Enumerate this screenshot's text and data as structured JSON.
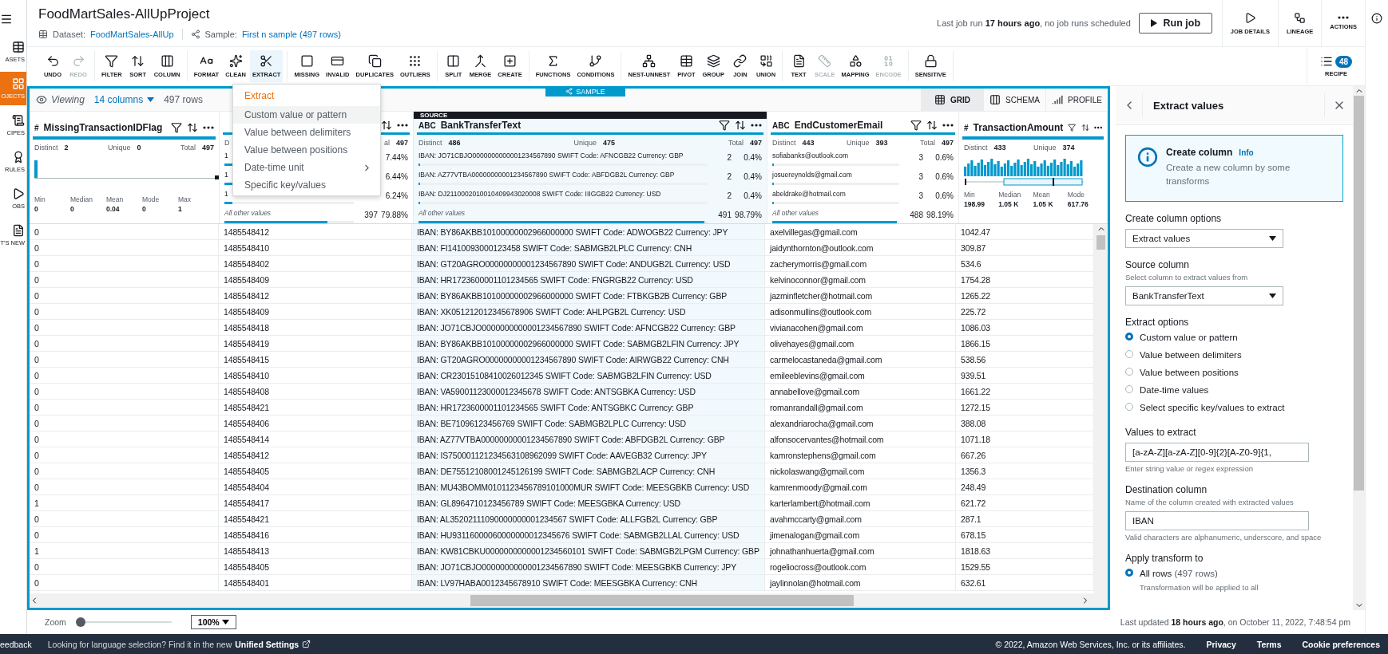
{
  "nav_rail": {
    "items": [
      {
        "label": "ASETS",
        "selected": false
      },
      {
        "label": "OJECTS",
        "selected": true
      },
      {
        "label": "CIPES",
        "selected": false
      },
      {
        "label": "RULES",
        "selected": false
      },
      {
        "label": "OBS",
        "selected": false
      },
      {
        "label": "T'S NEW",
        "selected": false
      }
    ]
  },
  "header": {
    "title": "FoodMartSales-AllUpProject",
    "dataset_label": "Dataset:",
    "dataset": "FoodMartSales-AllUp",
    "sample_label": "Sample:",
    "sample": "First n sample (497 rows)",
    "last_run": "Last job run **17 hours ago**, no job runs scheduled",
    "run_button": "Run job",
    "actions": [
      "JOB DETAILS",
      "LINEAGE",
      "ACTIONS"
    ]
  },
  "toolbar": {
    "groups": [
      {
        "items": [
          {
            "label": "UNDO",
            "disabled": false,
            "selected": false
          },
          {
            "label": "REDO",
            "disabled": true,
            "selected": false
          }
        ]
      },
      {
        "items": [
          {
            "label": "FILTER",
            "disabled": false,
            "selected": false
          },
          {
            "label": "SORT",
            "disabled": false,
            "selected": false
          },
          {
            "label": "COLUMN",
            "disabled": false,
            "selected": false
          }
        ]
      },
      {
        "items": [
          {
            "label": "FORMAT",
            "disabled": false,
            "selected": false
          },
          {
            "label": "CLEAN",
            "disabled": false,
            "selected": false
          },
          {
            "label": "EXTRACT",
            "disabled": false,
            "selected": true
          }
        ]
      },
      {
        "items": [
          {
            "label": "MISSING",
            "disabled": false,
            "selected": false
          },
          {
            "label": "INVALID",
            "disabled": false,
            "selected": false
          },
          {
            "label": "DUPLICATES",
            "disabled": false,
            "selected": false
          },
          {
            "label": "OUTLIERS",
            "disabled": false,
            "selected": false
          }
        ]
      },
      {
        "items": [
          {
            "label": "SPLIT",
            "disabled": false,
            "selected": false
          },
          {
            "label": "MERGE",
            "disabled": false,
            "selected": false
          },
          {
            "label": "CREATE",
            "disabled": false,
            "selected": false
          }
        ]
      },
      {
        "items": [
          {
            "label": "FUNCTIONS",
            "disabled": false,
            "selected": false
          },
          {
            "label": "CONDITIONS",
            "disabled": false,
            "selected": false
          }
        ]
      },
      {
        "items": [
          {
            "label": "NEST-UNNEST",
            "disabled": false,
            "selected": false
          },
          {
            "label": "PIVOT",
            "disabled": false,
            "selected": false
          },
          {
            "label": "GROUP",
            "disabled": false,
            "selected": false
          },
          {
            "label": "JOIN",
            "disabled": false,
            "selected": false
          },
          {
            "label": "UNION",
            "disabled": false,
            "selected": false
          }
        ]
      },
      {
        "items": [
          {
            "label": "TEXT",
            "disabled": false,
            "selected": false
          },
          {
            "label": "SCALE",
            "disabled": true,
            "selected": false
          },
          {
            "label": "MAPPING",
            "disabled": false,
            "selected": false
          },
          {
            "label": "ENCODE",
            "disabled": true,
            "selected": false
          }
        ]
      },
      {
        "items": [
          {
            "label": "SENSITIVE",
            "disabled": false,
            "selected": false
          }
        ]
      }
    ],
    "recipe": {
      "label": "RECIPE",
      "count": "48"
    }
  },
  "extract_menu": {
    "title": "Extract",
    "items": [
      {
        "label": "Custom value or pattern",
        "selected": true,
        "submenu": false
      },
      {
        "label": "Value between delimiters",
        "selected": false,
        "submenu": false
      },
      {
        "label": "Value between positions",
        "selected": false,
        "submenu": false
      },
      {
        "label": "Date-time unit",
        "selected": false,
        "submenu": true
      },
      {
        "label": "Specific key/values",
        "selected": false,
        "submenu": false
      }
    ]
  },
  "grid": {
    "viewing_label": "Viewing",
    "columns_link": "14 columns",
    "row_count": "497 rows",
    "sample_tag": "SAMPLE",
    "view_tabs": [
      {
        "label": "GRID",
        "selected": true
      },
      {
        "label": "SCHEMA",
        "selected": false
      },
      {
        "label": "PROFILE",
        "selected": false
      }
    ],
    "columns": [
      {
        "kind": "distribution",
        "type_mark": "#",
        "name": "MissingTransactionIDFlag",
        "source": false,
        "stats": {
          "distinct_label": "Distinct",
          "distinct": "2",
          "unique_label": "Unique",
          "unique": "0",
          "total_label": "Total",
          "total": "497"
        },
        "summary": [
          {
            "label": "Min",
            "value": "0"
          },
          {
            "label": "Median",
            "value": "0"
          },
          {
            "label": "Mean",
            "value": "0.04"
          },
          {
            "label": "Mode",
            "value": "0"
          },
          {
            "label": "Max",
            "value": "1"
          }
        ]
      },
      {
        "kind": "top_values",
        "source": false,
        "stats": {
          "distinct_label": "D",
          "total_label": "al",
          "total": "497"
        },
        "top_values": [
          {
            "value": "1",
            "percent": "7.44%",
            "level": 0.0744
          },
          {
            "value": "1",
            "percent": "6.44%",
            "level": 0.0644
          },
          {
            "value": "1",
            "percent": "6.24%",
            "level": 0.0624
          }
        ],
        "other": {
          "label": "All other values",
          "count": "397",
          "percent": "79.88%",
          "level": 0.7988
        }
      },
      {
        "kind": "top_values",
        "type_mark": "ABC",
        "name": "BankTransferText",
        "source": true,
        "source_tag": "SOURCE",
        "stats": {
          "distinct_label": "Distinct",
          "distinct": "486",
          "unique_label": "Unique",
          "unique": "475",
          "total_label": "Total",
          "total": "497"
        },
        "top_values": [
          {
            "value": "IBAN: JO71CBJO0000000000001234567890 SWIFT Code: AFNCGB22 Currency: GBP",
            "count": "2",
            "percent": "0.4%",
            "level": 0.004
          },
          {
            "value": "IBAN: AZ77VTBA00000000001234567890 SWIFT Code: ABFDGB2L Currency: GBP",
            "count": "2",
            "percent": "0.4%",
            "level": 0.004
          },
          {
            "value": "IBAN: DJ2110002010010409943020008 SWIFT Code: IIIGGB22 Currency: USD",
            "count": "2",
            "percent": "0.4%",
            "level": 0.004
          }
        ],
        "other": {
          "label": "All other values",
          "count": "491",
          "percent": "98.79%",
          "level": 0.9879
        }
      },
      {
        "kind": "top_values",
        "type_mark": "ABC",
        "name": "EndCustomerEmail",
        "source": false,
        "stats": {
          "distinct_label": "Distinct",
          "distinct": "443",
          "unique_label": "Unique",
          "unique": "393",
          "total_label": "Total",
          "total": "497"
        },
        "top_values": [
          {
            "value": "sofiabanks@outlook.com",
            "count": "3",
            "percent": "0.6%",
            "level": 0.006
          },
          {
            "value": "josuereynolds@gmail.com",
            "count": "3",
            "percent": "0.6%",
            "level": 0.006
          },
          {
            "value": "abeldrake@hotmail.com",
            "count": "3",
            "percent": "0.6%",
            "level": 0.006
          }
        ],
        "other": {
          "label": "All other values",
          "count": "488",
          "percent": "98.19%",
          "level": 0.9819
        }
      },
      {
        "kind": "histogram",
        "type_mark": "#",
        "name": "TransactionAmount",
        "source": false,
        "stats": {
          "distinct_label": "Distinct",
          "distinct": "433",
          "unique_label": "Unique",
          "unique": "374"
        },
        "summary": [
          {
            "label": "Min",
            "value": "198.99"
          },
          {
            "label": "Median",
            "value": "1.05 K"
          },
          {
            "label": "Mean",
            "value": "1.05 K"
          },
          {
            "label": "Mode",
            "value": "617.76"
          }
        ]
      }
    ],
    "rows": [
      [
        "0",
        "1485548412",
        "IBAN: BY86AKBB10100000002966000000 SWIFT Code: ADWOGB22 Currency: JPY",
        "axelvillegas@gmail.com",
        "1042.47"
      ],
      [
        "0",
        "1485548410",
        "IBAN: FI1410093000123458 SWIFT Code: SABMGB2LPLC Currency: CNH",
        "jaidynthornton@outlook.com",
        "309.87"
      ],
      [
        "0",
        "1485548402",
        "IBAN: GT20AGRO00000000001234567890 SWIFT Code: ANDUGB2L Currency: USD",
        "zacherymorris@gmail.com",
        "534.6"
      ],
      [
        "0",
        "1485548409",
        "IBAN: HR1723600001101234565 SWIFT Code: FNGRGB22 Currency: USD",
        "kelvinoconnor@gmail.com",
        "1754.28"
      ],
      [
        "0",
        "1485548412",
        "IBAN: BY86AKBB10100000002966000000 SWIFT Code: FTBKGB2B Currency: GBP",
        "jazminfletcher@hotmail.com",
        "1265.22"
      ],
      [
        "0",
        "1485548409",
        "IBAN: XK051212012345678906 SWIFT Code: AHLPGB2L Currency: USD",
        "adisonmullins@outlook.com",
        "225.72"
      ],
      [
        "0",
        "1485548418",
        "IBAN: JO71CBJO0000000000001234567890 SWIFT Code: AFNCGB22 Currency: GBP",
        "vivianacohen@gmail.com",
        "1086.03"
      ],
      [
        "0",
        "1485548419",
        "IBAN: BY86AKBB10100000002966000000 SWIFT Code: SABMGB2LFIN Currency: JPY",
        "olivehayes@gmail.com",
        "1866.15"
      ],
      [
        "0",
        "1485548415",
        "IBAN: GT20AGRO00000000001234567890 SWIFT Code: AIRWGB22 Currency: CNH",
        "carmelocastaneda@gmail.com",
        "538.56"
      ],
      [
        "0",
        "1485548410",
        "IBAN: CR23015108410026012345 SWIFT Code: SABMGB2LFIN Currency: USD",
        "emileeblevins@gmail.com",
        "939.51"
      ],
      [
        "0",
        "1485548408",
        "IBAN: VA59001123000012345678 SWIFT Code: ANTSGBKA Currency: USD",
        "annabellove@gmail.com",
        "1661.22"
      ],
      [
        "0",
        "1485548421",
        "IBAN: HR1723600001101234565 SWIFT Code: ANTSGBKC Currency: GBP",
        "romanrandall@gmail.com",
        "1272.15"
      ],
      [
        "0",
        "1485548406",
        "IBAN: BE71096123456769 SWIFT Code: SABMGB2LPLC Currency: USD",
        "alexandriarocha@gmail.com",
        "388.08"
      ],
      [
        "0",
        "1485548414",
        "IBAN: AZ77VTBA00000000001234567890 SWIFT Code: ABFDGB2L Currency: GBP",
        "alfonsocervantes@hotmail.com",
        "1071.18"
      ],
      [
        "0",
        "1485548412",
        "IBAN: IS750001121234563108962099 SWIFT Code: AAVEGB32 Currency: JPY",
        "kamronstephens@gmail.com",
        "667.26"
      ],
      [
        "0",
        "1485548405",
        "IBAN: DE75512108001245126199 SWIFT Code: SABMGB2LACP Currency: CNH",
        "nickolaswang@gmail.com",
        "1356.3"
      ],
      [
        "0",
        "1485548404",
        "IBAN: MU43BOMM0101123456789101000MUR SWIFT Code: MEESGBKB Currency: USD",
        "kamrenmoody@gmail.com",
        "248.49"
      ],
      [
        "1",
        "1485548417",
        "IBAN: GL8964710123456789 SWIFT Code: MEESGBKA Currency: USD",
        "karterlambert@hotmail.com",
        "621.72"
      ],
      [
        "0",
        "1485548421",
        "IBAN: AL35202111090000000001234567 SWIFT Code: ALLFGB2L Currency: GBP",
        "avahmccarty@gmail.com",
        "287.1"
      ],
      [
        "0",
        "1485548416",
        "IBAN: HU93116000060000000012345676 SWIFT Code: SABMGB2LLAL Currency: USD",
        "jimenalogan@gmail.com",
        "678.15"
      ],
      [
        "1",
        "1485548413",
        "IBAN: KW81CBKU0000000000001234560101 SWIFT Code: SABMGB2LPGM Currency: GBP",
        "johnathanhuerta@gmail.com",
        "1818.63"
      ],
      [
        "0",
        "1485548405",
        "IBAN: JO71CBJO0000000000001234567890 SWIFT Code: MEESGBKB Currency: JPY",
        "rogeliocross@outlook.com",
        "1529.55"
      ],
      [
        "0",
        "1485548401",
        "IBAN: LV97HABA0012345678910 SWIFT Code: MEESGBKA Currency: CNH",
        "jaylinnolan@hotmail.com",
        "632.61"
      ]
    ]
  },
  "panel": {
    "title": "Extract values",
    "info": {
      "title": "Create column",
      "link": "Info",
      "text": "Create a new column by some transforms"
    },
    "fields": [
      {
        "kind": "select",
        "label": "Create column options",
        "value": "Extract values"
      },
      {
        "kind": "select",
        "label": "Source column",
        "description": "Select column to extract values from",
        "value": "BankTransferText"
      },
      {
        "kind": "radios",
        "label": "Extract options",
        "options": [
          {
            "label": "Custom value or pattern",
            "selected": true
          },
          {
            "label": "Value between delimiters",
            "selected": false
          },
          {
            "label": "Value between positions",
            "selected": false
          },
          {
            "label": "Date-time values",
            "selected": false
          },
          {
            "label": "Select specific key/values to extract",
            "selected": false
          }
        ]
      },
      {
        "kind": "input",
        "label": "Values to extract",
        "value": "[a-zA-Z][a-zA-Z][0-9]{2}[A-Z0-9]{1,",
        "hint": "Enter string value or regex expression"
      },
      {
        "kind": "input",
        "label": "Destination column",
        "description": "Name of the column created with extracted values",
        "value": "IBAN",
        "hint": "Valid characters are alphanumeric, underscore, and space"
      },
      {
        "kind": "radios",
        "label": "Apply transform to",
        "options": [
          {
            "label": "All rows",
            "count": "(497 rows)",
            "description": "Transformation will be applied to all",
            "selected": true
          }
        ]
      }
    ],
    "last_updated": "Last updated **18 hours ago**, on October 11, 2022, 7:48:54 pm"
  },
  "bottom_bar": {
    "zoom_label": "Zoom",
    "zoom_slider": {
      "level": 0
    },
    "zoom_value": "100%"
  },
  "footer": {
    "feedback": "eedback",
    "notice": "Looking for language selection? Find it in the new",
    "notice_link": "Unified Settings",
    "copyright": "© 2022, Amazon Web Services, Inc. or its affiliates.",
    "links": [
      "Privacy",
      "Terms",
      "Cookie preferences"
    ]
  }
}
